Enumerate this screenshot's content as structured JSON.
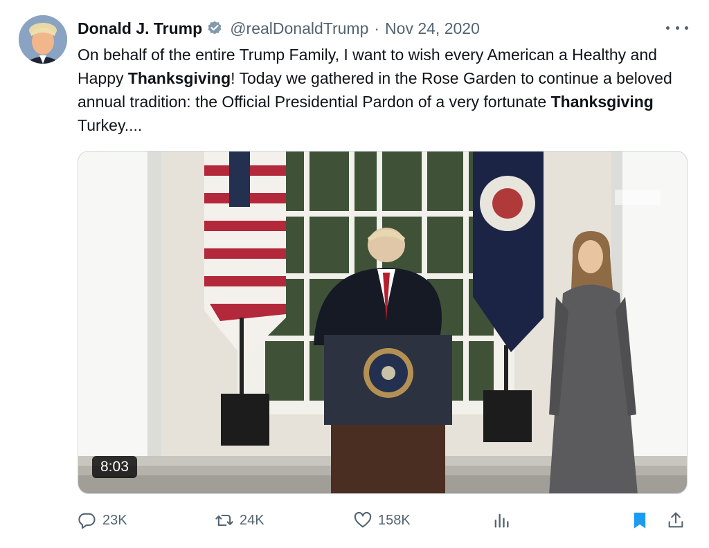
{
  "author": {
    "display_name": "Donald J. Trump",
    "handle": "@realDonaldTrump",
    "separator": "·",
    "date": "Nov 24, 2020",
    "verified_icon": "verified-badge-icon"
  },
  "tweet": {
    "segments": [
      {
        "text": "On behalf of the entire Trump Family, I want to wish every American a Healthy and Happy ",
        "bold": false
      },
      {
        "text": "Thanksgiving",
        "bold": true
      },
      {
        "text": "! Today we gathered in the Rose Garden to continue a beloved annual tradition: the Official Presidential Pardon of a very fortunate ",
        "bold": false
      },
      {
        "text": "Thanksgiving",
        "bold": true
      },
      {
        "text": " Turkey....",
        "bold": false
      }
    ]
  },
  "media": {
    "duration": "8:03"
  },
  "actions": {
    "replies": "23K",
    "reposts": "24K",
    "likes": "158K",
    "views_icon": "bar-chart-icon",
    "bookmark_icon": "bookmark-icon",
    "share_icon": "share-icon"
  },
  "colors": {
    "text": "#0f1419",
    "secondary": "#536471",
    "accent": "#1d9bf0"
  }
}
